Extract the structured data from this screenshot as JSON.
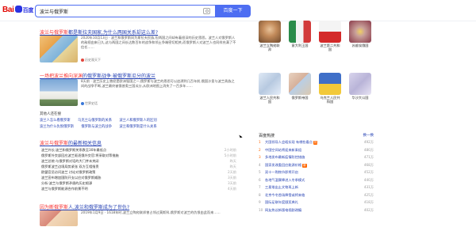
{
  "search": {
    "query": "波兰与俄罗斯",
    "button": "百度一下"
  },
  "logo": {
    "left": "Bai",
    "right": "百度"
  },
  "results": [
    {
      "title_hl": "波兰与俄罗斯",
      "title_rest": "都是斯拉夫国家,为什么两国关系却这么差?",
      "snippet": "2020年10月13日 · 波兰和俄罗斯同为斯拉夫民族,但两国之间却有着很深的历史恩怨。波兰人对俄罗斯人的敌视由来已久,这与两国之间长达数百年的战争和领土争端密切相关,而俄罗斯人对波兰人也同样充满了不信任……",
      "source": "历史观天下"
    },
    {
      "title_hl": "一场把波兰推向深渊",
      "title_rest": "的俄罗斯战争:被俄罗斯瓜分的波兰",
      "snippet": "8天前 · 波兰历史上曾经是欧洲强国之一,俄罗斯与波兰的恩怨可以追溯到几百年前,俄国沙皇与波兰贵族之间的战争不断,波兰最终被俄普奥三国瓜分,从欧洲地图上消失了一百多年……",
      "source": "世界史话"
    }
  ],
  "related": {
    "heading": "其他人还在搜",
    "rows": [
      [
        "波兰人怎么看俄罗斯",
        "乌克兰与俄罗斯的关系",
        "波兰人和俄罗斯人的区别"
      ],
      [
        "波兰为什么仇恨俄罗斯",
        "俄罗斯与波兰的战争",
        "波兰和俄罗斯是什么关系"
      ]
    ]
  },
  "news": {
    "title_hl": "波兰与俄罗斯",
    "title_rest": "的最新相关信息",
    "items": [
      {
        "text": "波兰外长:波兰和俄罗斯关系跌至30年最低点",
        "date": "2小时前"
      },
      {
        "text": "俄罗斯外交部回应波兰驱逐俄外交官:将采取对等措施",
        "date": "5小时前"
      },
      {
        "text": "波兰总统:与俄罗斯对话的大门并未关闭",
        "date": "昨天"
      },
      {
        "text": "俄罗斯波兰边境局势紧张 双方互相指责",
        "date": "昨天"
      },
      {
        "text": "欧盟官员访问波兰 讨论对俄罗斯政策",
        "date": "2天前"
      },
      {
        "text": "波兰宣布增加国防开支以应对俄罗斯威胁",
        "date": "3天前"
      },
      {
        "text": "分析:波兰与俄罗斯矛盾的历史根源",
        "date": "3天前"
      },
      {
        "text": "波兰与俄罗斯能源合作前景不明",
        "date": "4天前"
      }
    ]
  },
  "result3": {
    "title_hl": "因为断俄罗斯",
    "title_rest": "人,波兰和俄罗斯成为了世仇?",
    "snippet": "2019年1月9日 · 1618年时,波兰立陶宛联邦曾占领过莫斯科,俄罗斯对波兰的仇恨由此而来……"
  },
  "right_cards": [
    {
      "label": "波兰立陶宛联邦",
      "color": "#c28a5a"
    },
    {
      "label": "意大利王国",
      "color": "#d8d0c4"
    },
    {
      "label": "波兰第二共和国",
      "color": "#cf3a3a"
    },
    {
      "label": "苏维埃俄国",
      "color": "#c9a09a"
    },
    {
      "label": "波兰人民共和国",
      "color": "#b7c9e0"
    },
    {
      "label": "俄罗斯帝国",
      "color": "#d6b09a"
    },
    {
      "label": "乌克兰人民共和国",
      "color": "#e9c13a"
    },
    {
      "label": "华沙大公国",
      "color": "#b9b4d8"
    }
  ],
  "hot": {
    "heading": "百度热搜",
    "change": "换一换",
    "items": [
      {
        "n": "1",
        "text": "大国领导人会晤实现 有哪些看点",
        "tag": "热",
        "value": "492万"
      },
      {
        "n": "2",
        "text": "中国空间站将迎来新乘组",
        "tag": "",
        "value": "480万"
      },
      {
        "n": "3",
        "text": "多地发布最新疫情防控措施",
        "tag": "",
        "value": "471万"
      },
      {
        "n": "4",
        "text": "国家发改委回应能源价格",
        "tag": "新",
        "value": "468万"
      },
      {
        "n": "5",
        "text": "双十一购物节即将开启",
        "tag": "",
        "value": "452万"
      },
      {
        "n": "6",
        "text": "各地气温骤降进入冬季模式",
        "tag": "",
        "value": "440万"
      },
      {
        "n": "7",
        "text": "三星堆出土文物再上新",
        "tag": "",
        "value": "431万"
      },
      {
        "n": "8",
        "text": "北京今冬首场降雪或将来临",
        "tag": "",
        "value": "425万"
      },
      {
        "n": "9",
        "text": "国际足联年度颁奖典礼",
        "tag": "",
        "value": "418万"
      },
      {
        "n": "10",
        "text": "网友热议新版电视剧改编",
        "tag": "",
        "value": "402万"
      }
    ]
  }
}
